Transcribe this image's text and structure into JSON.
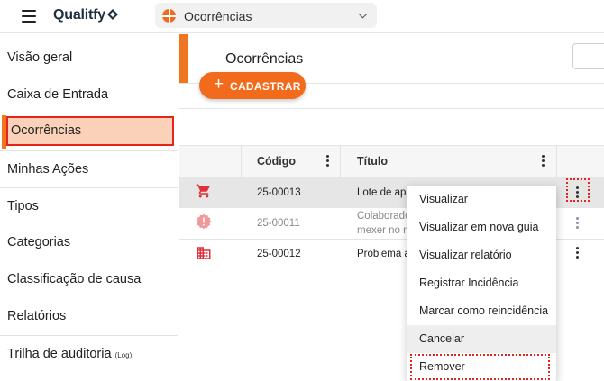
{
  "app": {
    "logo_text": "Qualitfy",
    "module_selector": {
      "selected": "Ocorrências"
    }
  },
  "sidebar": {
    "items": [
      {
        "label": "Visão geral"
      },
      {
        "label": "Caixa de Entrada"
      },
      {
        "label": "Ocorrências",
        "active": true
      },
      {
        "label": "Minhas Ações"
      },
      {
        "label": "Tipos"
      },
      {
        "label": "Categorias"
      },
      {
        "label": "Classificação de causa"
      },
      {
        "label": "Relatórios"
      },
      {
        "label": "Trilha de auditoria",
        "suffix": "(Log)"
      }
    ]
  },
  "main": {
    "title": "Ocorrências",
    "add_button": {
      "label": "CADASTRAR"
    }
  },
  "table": {
    "columns": [
      "Código",
      "Título"
    ],
    "rows": [
      {
        "icon": "cart-icon",
        "code": "25-00013",
        "title": "Lote de apa",
        "icon_color": "#e0303a"
      },
      {
        "icon": "alert-badge-icon",
        "code": "25-00011",
        "title_line1": "Colaborado",
        "title_line2": "mexer no m",
        "icon_color": "#ef9a9a"
      },
      {
        "icon": "building-icon",
        "code": "25-00012",
        "title": "Problema a",
        "icon_color": "#e0303a"
      }
    ]
  },
  "context_menu": {
    "items": [
      "Visualizar",
      "Visualizar em nova guia",
      "Visualizar relatório",
      "Registrar Incidência",
      "Marcar como reincidência",
      "Cancelar",
      "Remover"
    ]
  },
  "colors": {
    "accent": "#f26a1b",
    "highlight_red": "#e5241b",
    "active_fill": "#fbd2b9"
  }
}
